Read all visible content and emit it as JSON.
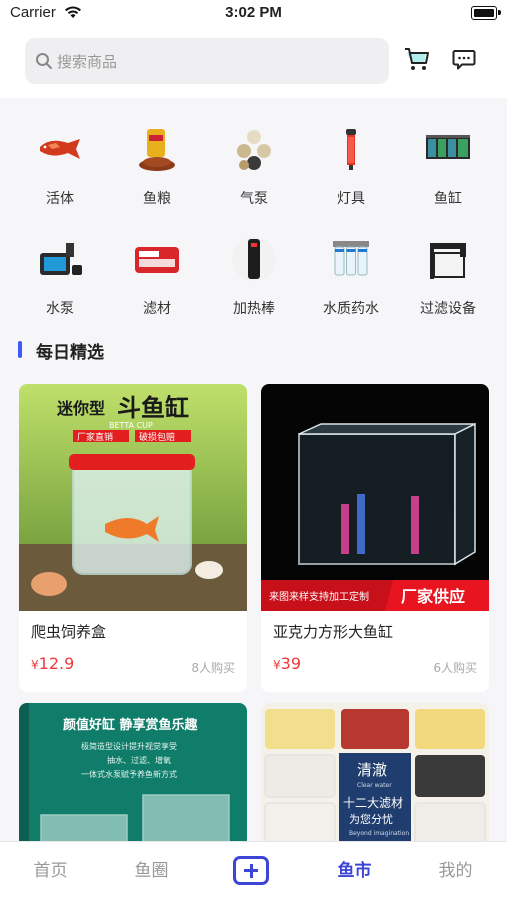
{
  "status_bar": {
    "carrier": "Carrier",
    "time": "3:02 PM"
  },
  "header": {
    "search_placeholder": "搜索商品",
    "icons": [
      "search-icon",
      "cart-icon",
      "message-icon"
    ]
  },
  "categories": [
    {
      "label": "活体",
      "icon": "arowana-fish-icon"
    },
    {
      "label": "鱼粮",
      "icon": "fish-food-icon"
    },
    {
      "label": "气泵",
      "icon": "air-pump-icon"
    },
    {
      "label": "灯具",
      "icon": "lamp-icon"
    },
    {
      "label": "鱼缸",
      "icon": "fish-tank-icon"
    },
    {
      "label": "水泵",
      "icon": "water-pump-icon"
    },
    {
      "label": "滤材",
      "icon": "filter-media-icon"
    },
    {
      "label": "加热棒",
      "icon": "heater-rod-icon"
    },
    {
      "label": "水质药水",
      "icon": "water-treatment-icon"
    },
    {
      "label": "过滤设备",
      "icon": "filter-device-icon"
    }
  ],
  "section": {
    "title": "每日精选"
  },
  "products": [
    {
      "name": "爬虫饲养盒",
      "currency": "¥",
      "price": "12.9",
      "buyers": "8人购买",
      "image_text": {
        "line1_small": "迷你型",
        "line1_big": "斗鱼缸",
        "sub": "BETTA CUP",
        "tag1": "厂家直销",
        "tag2": "破损包赔"
      }
    },
    {
      "name": "亚克力方形大鱼缸",
      "currency": "¥",
      "price": "39",
      "buyers": "6人购买",
      "image_text": {
        "banner_left": "来图来样支持加工定制",
        "banner_right": "厂家供应"
      }
    },
    {
      "name": "",
      "currency": "",
      "price": "",
      "buyers": "",
      "image_text": {
        "headline": "颜值好缸  静享赏鱼乐趣",
        "l1": "极简造型设计提升视觉享受",
        "l2": "抽水、过滤、增氧",
        "l3": "一体式水泵赋予养鱼新方式"
      }
    },
    {
      "name": "",
      "currency": "",
      "price": "",
      "buyers": "",
      "image_text": {
        "t1": "清澈",
        "t2": "Clear water",
        "t3": "十二大滤材",
        "t4": "为您分忧",
        "t5": "Beyond imagination"
      }
    }
  ],
  "tabbar": {
    "items": [
      "首页",
      "鱼圈",
      "鱼市",
      "我的"
    ],
    "active": "鱼市"
  },
  "colors": {
    "accent": "#3d45d6",
    "price": "#ee3a3a",
    "section_bar": "#3d5afe"
  }
}
